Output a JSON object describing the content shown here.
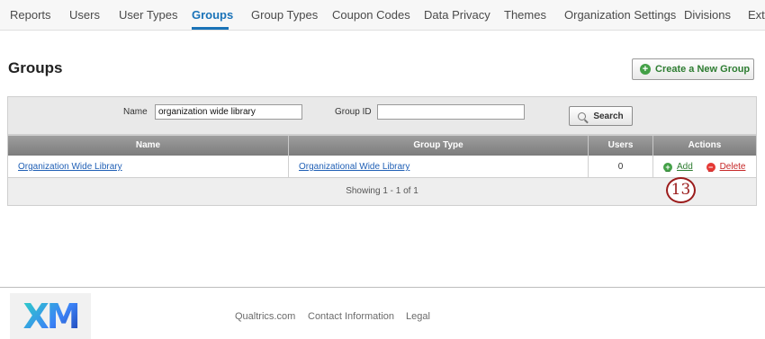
{
  "nav": {
    "tabs": [
      "Reports",
      "Users",
      "User Types",
      "Groups",
      "Group Types",
      "Coupon Codes",
      "Data Privacy",
      "Themes",
      "Organization Settings",
      "Divisions",
      "Exte"
    ],
    "active": "Groups"
  },
  "page": {
    "title": "Groups",
    "create_label": "Create a New Group"
  },
  "search": {
    "name_label": "Name",
    "name_value": "organization wide library",
    "group_id_label": "Group ID",
    "group_id_value": "",
    "button_label": "Search"
  },
  "table": {
    "columns": [
      "Name",
      "Group Type",
      "Users",
      "Actions"
    ],
    "rows": [
      {
        "name": "Organization Wide Library",
        "group_type": "Organizational Wide Library",
        "users": "0",
        "add": "Add",
        "delete": "Delete"
      }
    ],
    "pager": "Showing 1 - 1 of  1"
  },
  "callout": "13",
  "footer": {
    "logo": "XM",
    "links": [
      "Qualtrics.com",
      "Contact Information",
      "Legal"
    ]
  },
  "colors": {
    "accent": "#1a73b8",
    "add": "#43a047",
    "delete": "#e53935",
    "callout": "#9b1c1c"
  }
}
